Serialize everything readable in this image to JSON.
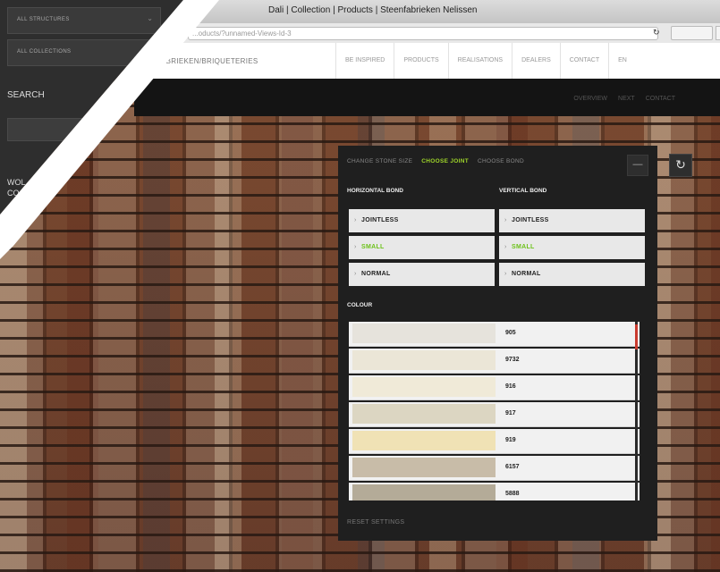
{
  "browser": {
    "title": "Dali | Collection | Products | Steenfabrieken Nelissen",
    "url": "...oducts/?unnamed-Views-Id-3",
    "reload_icon": "reload-icon"
  },
  "site": {
    "brand": "ABRIEKEN/BRIQUETERIES",
    "menu": [
      "BE INSPIRED",
      "PRODUCTS",
      "REALISATIONS",
      "DEALERS",
      "CONTACT",
      "EN"
    ],
    "subnav": [
      "OVERVIEW",
      "NEXT",
      "CONTACT"
    ]
  },
  "sidebar": {
    "structures_label": "ALL STRUCTURES",
    "collections_label": "ALL COLLECTIONS",
    "search_label": "SEARCH",
    "text_line1": "WOL",
    "text_line2": "CO"
  },
  "panel": {
    "tabs": [
      {
        "label": "CHANGE STONE SIZE",
        "active": false
      },
      {
        "label": "CHOOSE JOINT",
        "active": true
      },
      {
        "label": "CHOOSE BOND",
        "active": false
      }
    ],
    "collapse_icon": "minus-icon",
    "horizontal_title": "HORIZONTAL BOND",
    "vertical_title": "VERTICAL BOND",
    "horizontal_options": [
      "JOINTLESS",
      "SMALL",
      "NORMAL"
    ],
    "vertical_options": [
      "JOINTLESS",
      "SMALL",
      "NORMAL"
    ],
    "selected_option": "SMALL",
    "colour_title": "COLOUR",
    "swatches": [
      {
        "code": "905",
        "color": "#e6e3dc"
      },
      {
        "code": "9732",
        "color": "#ebe6d7"
      },
      {
        "code": "916",
        "color": "#f0ead8"
      },
      {
        "code": "917",
        "color": "#dcd6c2"
      },
      {
        "code": "919",
        "color": "#f0e2b5"
      },
      {
        "code": "6157",
        "color": "#c8bca8"
      },
      {
        "code": "5888",
        "color": "#b4ab98"
      }
    ],
    "reset_label": "RESET SETTINGS",
    "accent": "#9fd62a",
    "scroll_accent": "#c93a2e"
  },
  "refresh_icon": "refresh-icon"
}
